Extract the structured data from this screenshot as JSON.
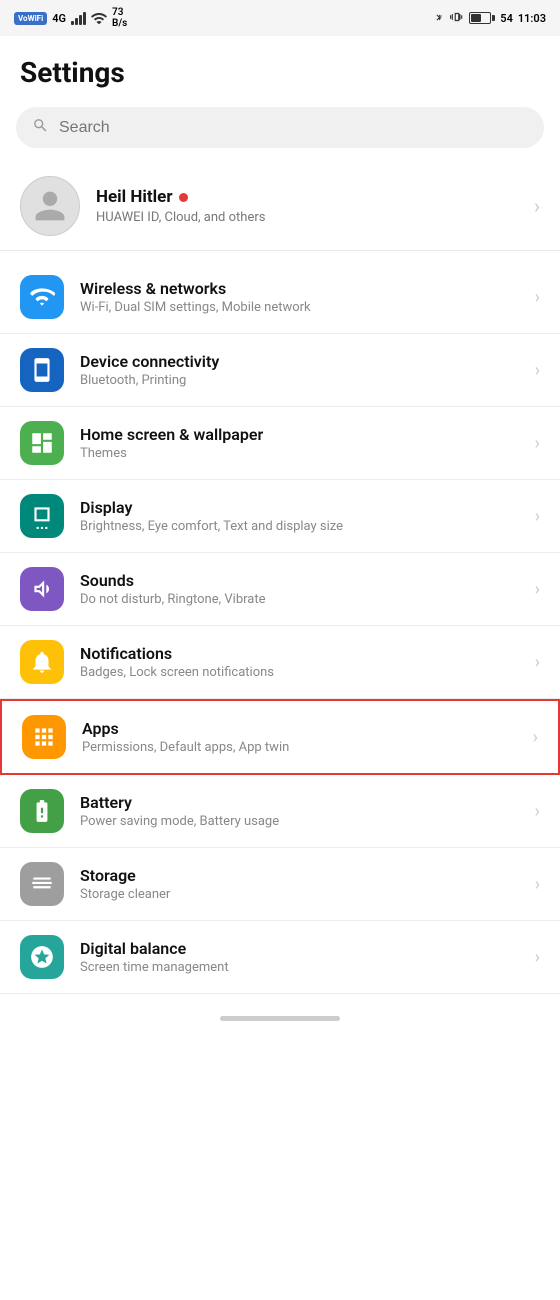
{
  "statusBar": {
    "wifiLabel": "VoWiFi",
    "networkType": "4G",
    "signalBars": 4,
    "wifiSignal": "wifi",
    "speed": "73\nB/s",
    "bluetooth": "bluetooth",
    "vibrate": "vibrate",
    "battery": "54",
    "time": "11:03"
  },
  "page": {
    "title": "Settings"
  },
  "search": {
    "placeholder": "Search"
  },
  "profile": {
    "name": "Heil Hitler",
    "subtitle": "HUAWEI ID, Cloud, and others"
  },
  "settingsItems": [
    {
      "id": "wireless",
      "title": "Wireless & networks",
      "subtitle": "Wi-Fi, Dual SIM settings, Mobile network",
      "iconColor": "blue",
      "icon": "wifi"
    },
    {
      "id": "device",
      "title": "Device connectivity",
      "subtitle": "Bluetooth, Printing",
      "iconColor": "blue2",
      "icon": "device"
    },
    {
      "id": "homescreen",
      "title": "Home screen & wallpaper",
      "subtitle": "Themes",
      "iconColor": "green",
      "icon": "home"
    },
    {
      "id": "display",
      "title": "Display",
      "subtitle": "Brightness, Eye comfort, Text and display size",
      "iconColor": "teal",
      "icon": "display"
    },
    {
      "id": "sounds",
      "title": "Sounds",
      "subtitle": "Do not disturb, Ringtone, Vibrate",
      "iconColor": "purple",
      "icon": "sounds"
    },
    {
      "id": "notifications",
      "title": "Notifications",
      "subtitle": "Badges, Lock screen notifications",
      "iconColor": "yellow",
      "icon": "notifications"
    },
    {
      "id": "apps",
      "title": "Apps",
      "subtitle": "Permissions, Default apps, App twin",
      "iconColor": "orange",
      "icon": "apps",
      "highlighted": true
    },
    {
      "id": "battery",
      "title": "Battery",
      "subtitle": "Power saving mode, Battery usage",
      "iconColor": "green2",
      "icon": "battery"
    },
    {
      "id": "storage",
      "title": "Storage",
      "subtitle": "Storage cleaner",
      "iconColor": "gray",
      "icon": "storage"
    },
    {
      "id": "digitalbalance",
      "title": "Digital balance",
      "subtitle": "Screen time management",
      "iconColor": "teal2",
      "icon": "digitalbalance"
    }
  ]
}
